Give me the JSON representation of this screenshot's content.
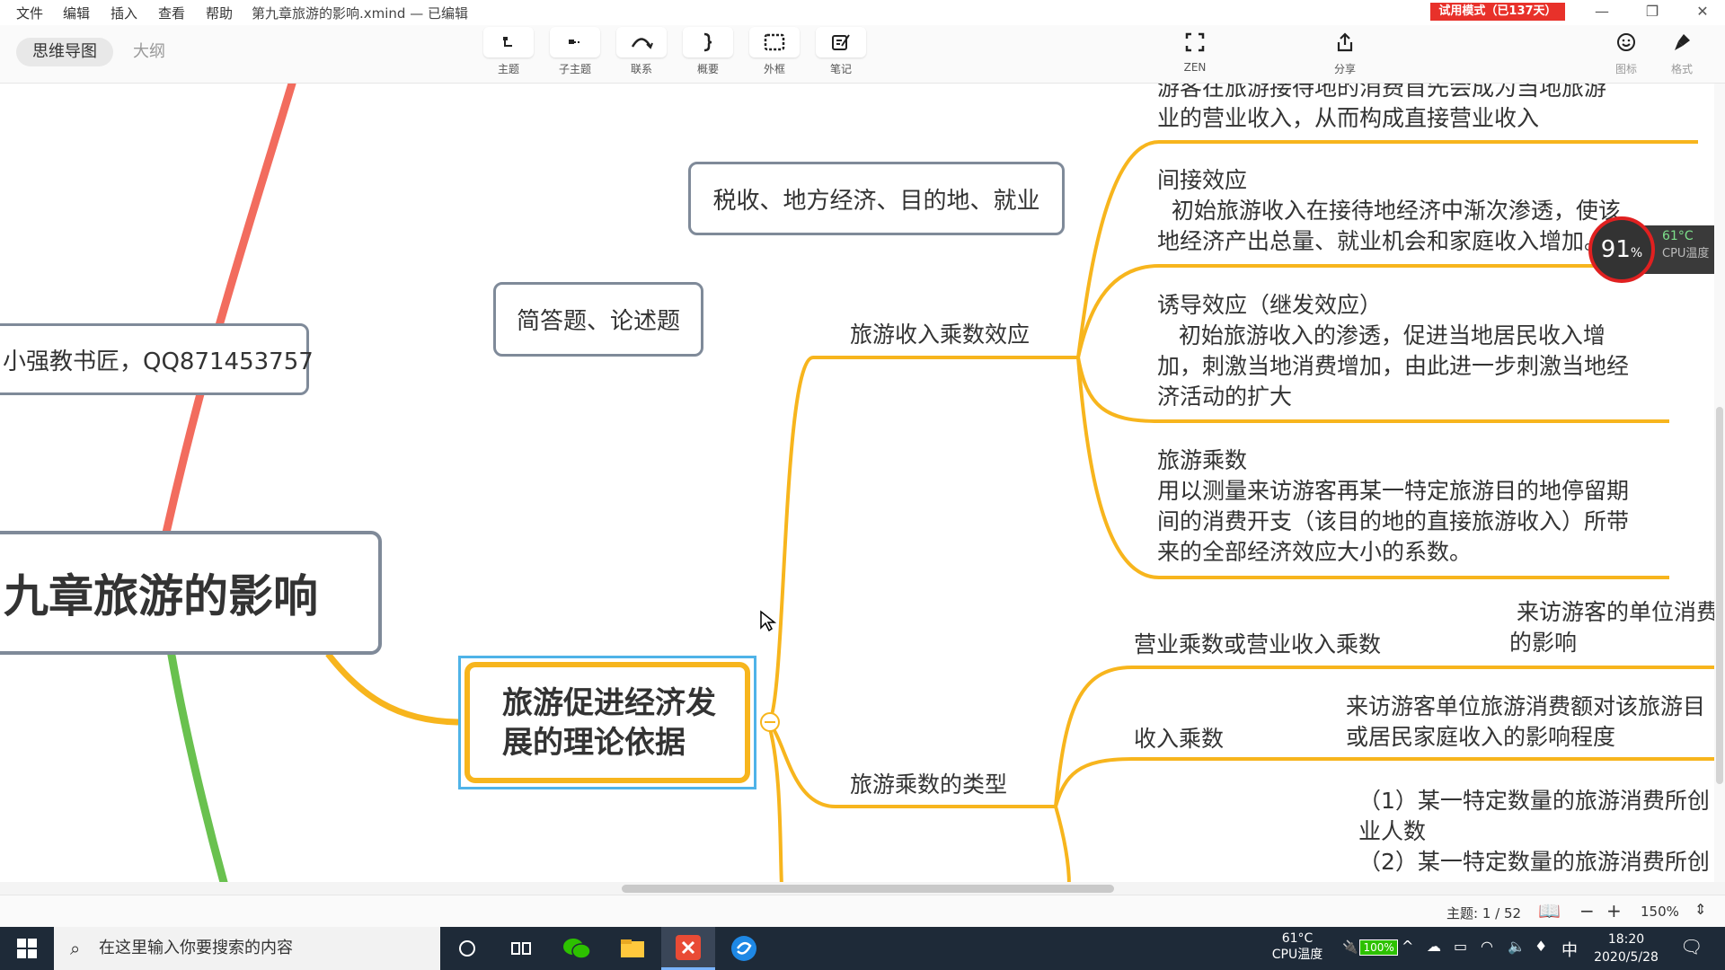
{
  "menubar": {
    "items": [
      "文件",
      "编辑",
      "插入",
      "查看",
      "帮助"
    ],
    "title": "第九章旅游的影响.xmind — 已编辑",
    "trial": "试用模式（已137天）"
  },
  "toolbar": {
    "views": [
      "思维导图",
      "大纲"
    ],
    "tools": [
      {
        "label": "主题",
        "icon": "topic-icon"
      },
      {
        "label": "子主题",
        "icon": "subtopic-icon"
      },
      {
        "label": "联系",
        "icon": "relationship-icon"
      },
      {
        "label": "概要",
        "icon": "summary-icon"
      },
      {
        "label": "外框",
        "icon": "boundary-icon"
      },
      {
        "label": "笔记",
        "icon": "note-icon"
      }
    ],
    "zen": "ZEN",
    "share": "分享",
    "icons_label": "图标",
    "format_label": "格式"
  },
  "canvas": {
    "central": "九章旅游的影响",
    "note_contact": "小强教书匠，QQ871453757",
    "tag_tax": "税收、地方经济、目的地、就业",
    "tag_questions": "简答题、论述题",
    "main_topic": "旅游促进经济发\n展的理论依据",
    "branch_multiplier_effect": "旅游收入乘数效应",
    "branch_multiplier_types": "旅游乘数的类型",
    "text_direct": "游客在旅游接待地的消费首先会成为当地旅游\n业的营业收入，从而构成直接营业收入",
    "text_indirect": "间接效应\n  初始旅游收入在接待地经济中渐次渗透，使该\n地经济产出总量、就业机会和家庭收入增加。",
    "text_induced": "诱导效应（继发效应）\n   初始旅游收入的渗透，促进当地居民收入增\n加，刺激当地消费增加，由此进一步刺激当地经\n济活动的扩大",
    "text_multiplier": "旅游乘数\n用以测量来访游客再某一特定旅游目的地停留期\n间的消费开支（该目的地的直接旅游收入）所带\n来的全部经济效应大小的系数。",
    "label_sales_multiplier": "营业乘数或营业收入乘数",
    "text_sales_multiplier": " 来访游客的单位消费\n的影响",
    "label_income_multiplier": "收入乘数",
    "text_income_multiplier": "来访游客单位旅游消费额对该旅游目\n或居民家庭收入的影响程度",
    "text_employment": "（1）某一特定数量的旅游消费所创\n业人数\n（2）某一特定数量的旅游消费所创"
  },
  "cpu_widget": {
    "percent": "91",
    "percent_unit": "%",
    "temp": "61°C",
    "temp_label": "CPU温度"
  },
  "statusbar": {
    "topic_count": "主题: 1 / 52",
    "zoom": "150%"
  },
  "taskbar": {
    "search_placeholder": "在这里输入你要搜索的内容",
    "cpu_temp": "61°C",
    "cpu_temp_label": "CPU温度",
    "battery": "100%",
    "ime": "中",
    "time": "18:20",
    "date": "2020/5/28"
  },
  "colors": {
    "branch_orange": "#f7b51d",
    "branch_red": "#f26c5e",
    "branch_green": "#69c14f",
    "focus_blue": "#4fb3e8",
    "node_border": "#7f8a99",
    "trial_red": "#e8312a"
  }
}
